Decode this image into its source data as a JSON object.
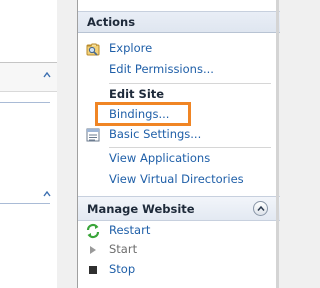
{
  "actions_pane": {
    "title": "Actions",
    "items": [
      {
        "label": "Explore",
        "icon": "explore-icon"
      },
      {
        "label": "Edit Permissions...",
        "icon": ""
      }
    ],
    "edit_site": {
      "heading": "Edit Site",
      "items": [
        {
          "label": "Bindings...",
          "icon": ""
        },
        {
          "label": "Basic Settings...",
          "icon": "settings-icon"
        },
        {
          "label": "View Applications",
          "icon": ""
        },
        {
          "label": "View Virtual Directories",
          "icon": ""
        }
      ]
    }
  },
  "manage_website": {
    "title": "Manage Website",
    "items": [
      {
        "label": "Restart",
        "icon": "restart-icon",
        "enabled": true
      },
      {
        "label": "Start",
        "icon": "start-icon",
        "enabled": false
      },
      {
        "label": "Stop",
        "icon": "stop-icon",
        "enabled": true
      }
    ]
  },
  "colors": {
    "link": "#1f5fa8",
    "highlight_box": "#f08524",
    "restart_icon": "#3aa53a"
  }
}
